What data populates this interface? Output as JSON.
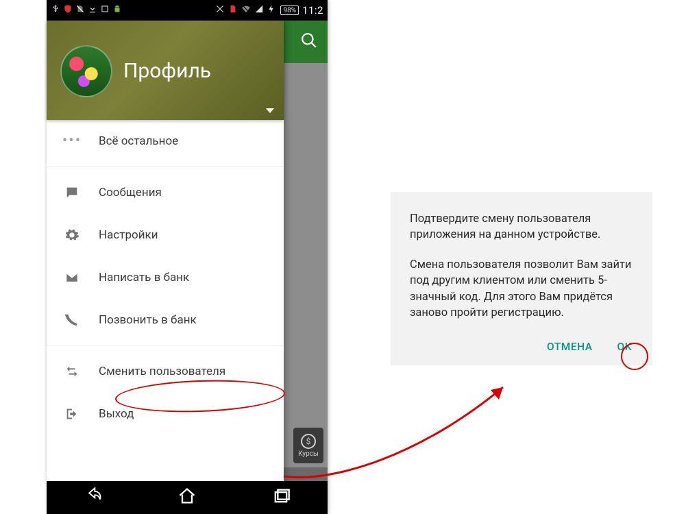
{
  "statusbar": {
    "battery_text": "98%",
    "clock": "11:2"
  },
  "drawer": {
    "title": "Профиль",
    "items": [
      {
        "id": "more",
        "label": "Всё остальное",
        "icon": "dots-icon"
      },
      {
        "id": "msgs",
        "label": "Сообщения",
        "icon": "chat-icon"
      },
      {
        "id": "settings",
        "label": "Настройки",
        "icon": "gear-icon"
      },
      {
        "id": "write",
        "label": "Написать в банк",
        "icon": "mail-icon"
      },
      {
        "id": "call",
        "label": "Позвонить в банк",
        "icon": "phone-icon"
      },
      {
        "id": "change",
        "label": "Сменить пользователя",
        "icon": "swap-icon"
      },
      {
        "id": "exit",
        "label": "Выход",
        "icon": "logout-icon"
      }
    ]
  },
  "behind": {
    "chip_label": "Курсы",
    "chip_symbol": "$"
  },
  "dialog": {
    "p1": "Подтвердите смену пользователя приложения на данном устройстве.",
    "p2": "Смена пользователя позволит Вам зайти под другим клиентом или сменить 5-значный код. Для этого Вам придётся заново пройти регистрацию.",
    "cancel": "ОТМЕНА",
    "ok": "OK"
  }
}
